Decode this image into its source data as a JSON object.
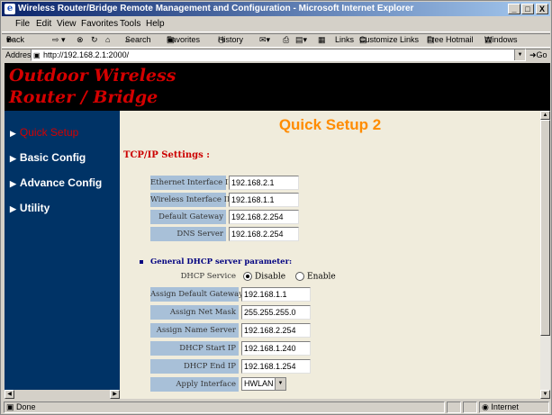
{
  "window": {
    "title": "Wireless Router/Bridge Remote Management and Configuration - Microsoft Internet Explorer",
    "minimize": "_",
    "maximize": "□",
    "close": "X"
  },
  "menu": [
    "File",
    "Edit",
    "View",
    "Favorites",
    "Tools",
    "Help"
  ],
  "toolbar": {
    "back": "Back",
    "search": "Search",
    "favorites": "Favorites",
    "history": "History",
    "links": "Links",
    "customize_links": "Customize Links",
    "free_hotmail": "Free Hotmail",
    "windows": "Windows"
  },
  "address": {
    "label": "Address",
    "url": "http://192.168.2.1:2000/",
    "go": "Go"
  },
  "header": {
    "line1": "Outdoor Wireless",
    "line2": "Router / Bridge"
  },
  "nav": [
    {
      "label": "Quick Setup"
    },
    {
      "label": "Basic Config"
    },
    {
      "label": "Advance Config"
    },
    {
      "label": "Utility"
    }
  ],
  "page": {
    "title": "Quick Setup 2",
    "tcpip_heading": "TCP/IP Settings :",
    "tcpip": [
      {
        "label": "Ethernet Interface IP",
        "value": "192.168.2.1"
      },
      {
        "label": "Wireless Interface IP",
        "value": "192.168.1.1"
      },
      {
        "label": "Default Gateway",
        "value": "192.168.2.254"
      },
      {
        "label": "DNS Server",
        "value": "192.168.2.254"
      }
    ],
    "dhcp_heading": "General DHCP server parameter:",
    "dhcp_service_label": "DHCP Service",
    "dhcp_disable": "Disable",
    "dhcp_enable": "Enable",
    "dhcp": [
      {
        "label": "Assign Default Gateway",
        "value": "192.168.1.1"
      },
      {
        "label": "Assign Net Mask",
        "value": "255.255.255.0"
      },
      {
        "label": "Assign Name Server",
        "value": "192.168.2.254"
      },
      {
        "label": "DHCP Start IP",
        "value": "192.168.1.240"
      },
      {
        "label": "DHCP End IP",
        "value": "192.168.1.254"
      }
    ],
    "apply_interface_label": "Apply Interface",
    "apply_interface_value": "HWLAN"
  },
  "status": {
    "left": "Done",
    "zone": "Internet"
  }
}
